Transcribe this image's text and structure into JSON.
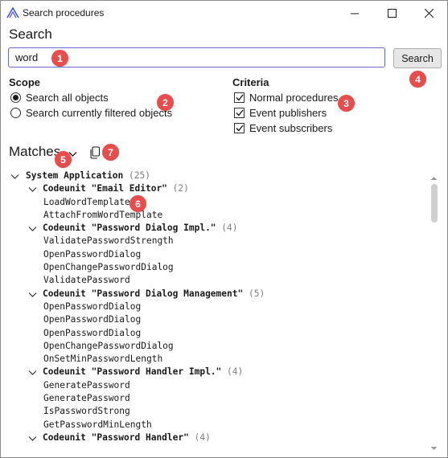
{
  "window": {
    "title": "Search procedures"
  },
  "search": {
    "heading": "Search",
    "value": "word",
    "placeholder": "",
    "button_label": "Search"
  },
  "scope": {
    "label": "Scope",
    "options": [
      {
        "label": "Search all objects",
        "checked": true
      },
      {
        "label": "Search currently filtered objects",
        "checked": false
      }
    ]
  },
  "criteria": {
    "label": "Criteria",
    "options": [
      {
        "label": "Normal procedures",
        "checked": true
      },
      {
        "label": "Event publishers",
        "checked": true
      },
      {
        "label": "Event subscribers",
        "checked": true
      }
    ]
  },
  "matches": {
    "label": "Matches"
  },
  "badges": [
    "1",
    "2",
    "3",
    "4",
    "5",
    "6",
    "7"
  ],
  "tree": [
    {
      "level": 0,
      "name": "System Application",
      "count": "(25)"
    },
    {
      "level": 1,
      "name": "Codeunit \"Email Editor\"",
      "count": "(2)"
    },
    {
      "level": 2,
      "name": "LoadWordTemplate"
    },
    {
      "level": 2,
      "name": "AttachFromWordTemplate"
    },
    {
      "level": 1,
      "name": "Codeunit \"Password Dialog Impl.\"",
      "count": "(4)"
    },
    {
      "level": 2,
      "name": "ValidatePasswordStrength"
    },
    {
      "level": 2,
      "name": "OpenPasswordDialog"
    },
    {
      "level": 2,
      "name": "OpenChangePasswordDialog"
    },
    {
      "level": 2,
      "name": "ValidatePassword"
    },
    {
      "level": 1,
      "name": "Codeunit \"Password Dialog Management\"",
      "count": "(5)"
    },
    {
      "level": 2,
      "name": "OpenPasswordDialog"
    },
    {
      "level": 2,
      "name": "OpenPasswordDialog"
    },
    {
      "level": 2,
      "name": "OpenPasswordDialog"
    },
    {
      "level": 2,
      "name": "OpenChangePasswordDialog"
    },
    {
      "level": 2,
      "name": "OnSetMinPasswordLength"
    },
    {
      "level": 1,
      "name": "Codeunit \"Password Handler Impl.\"",
      "count": "(4)"
    },
    {
      "level": 2,
      "name": "GeneratePassword"
    },
    {
      "level": 2,
      "name": "GeneratePassword"
    },
    {
      "level": 2,
      "name": "IsPasswordStrong"
    },
    {
      "level": 2,
      "name": "GetPasswordMinLength"
    },
    {
      "level": 1,
      "name": "Codeunit \"Password Handler\"",
      "count": "(4)"
    }
  ],
  "colors": {
    "accent": "#6b6bd6",
    "badge": "#e84d4d"
  }
}
